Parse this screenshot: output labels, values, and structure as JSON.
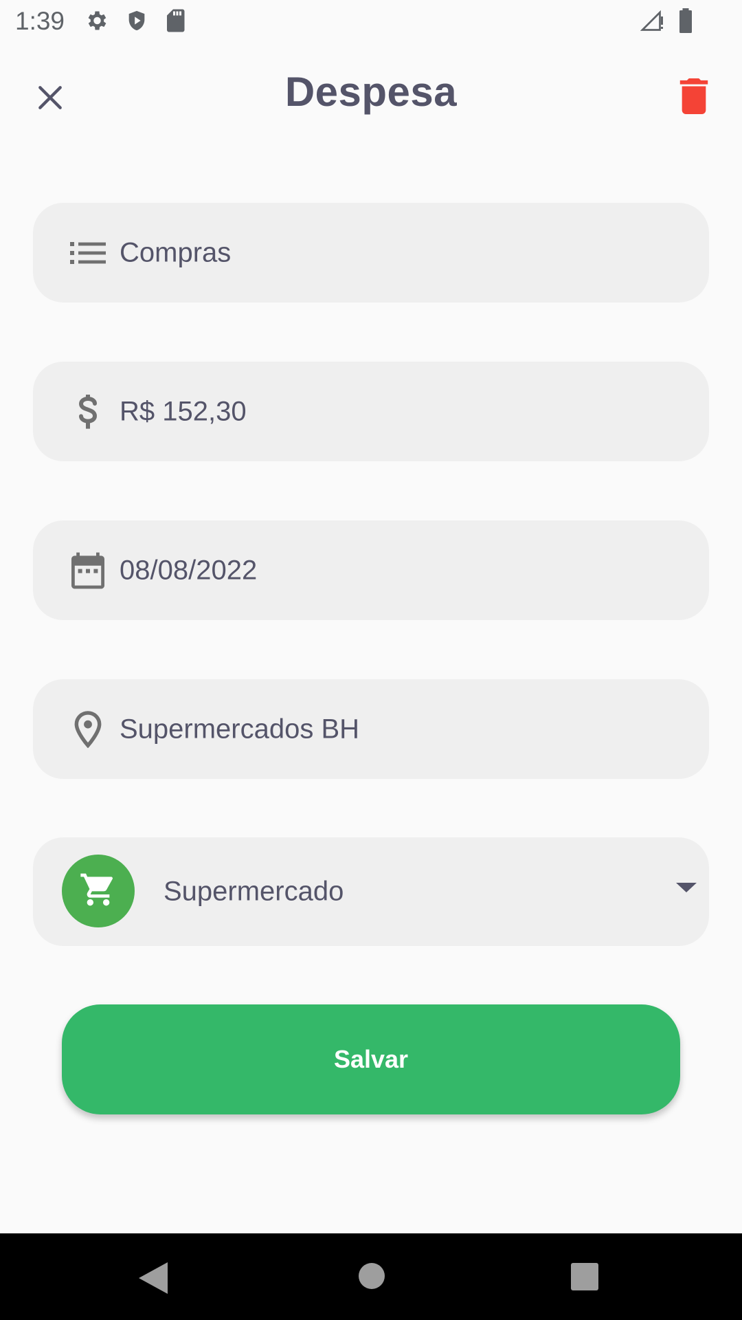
{
  "status_bar": {
    "time": "1:39",
    "left_icons": [
      "gear-icon",
      "shield-icon",
      "sd-card-icon"
    ],
    "right_icons": [
      "signal-no-data-icon",
      "battery-icon"
    ]
  },
  "header": {
    "title": "Despesa",
    "close_icon": "close-icon",
    "delete_icon": "trash-icon"
  },
  "form": {
    "description": {
      "value": "Compras",
      "icon": "list-icon"
    },
    "amount": {
      "value": "R$ 152,30",
      "icon": "dollar-icon"
    },
    "date": {
      "value": "08/08/2022",
      "icon": "calendar-icon"
    },
    "location": {
      "value": "Supermercados BH",
      "icon": "location-pin-icon"
    },
    "category": {
      "value": "Supermercado",
      "icon": "cart-icon",
      "dropdown_icon": "dropdown-arrow-icon"
    }
  },
  "save_button": {
    "label": "Salvar"
  },
  "nav_bar": {
    "buttons": [
      "back-icon",
      "home-icon",
      "recents-icon"
    ]
  },
  "colors": {
    "background": "#fafafa",
    "field_background": "#efefef",
    "text": "#545469",
    "accent_green": "#34b869",
    "category_green": "#4caf50",
    "delete_red": "#f44336"
  }
}
